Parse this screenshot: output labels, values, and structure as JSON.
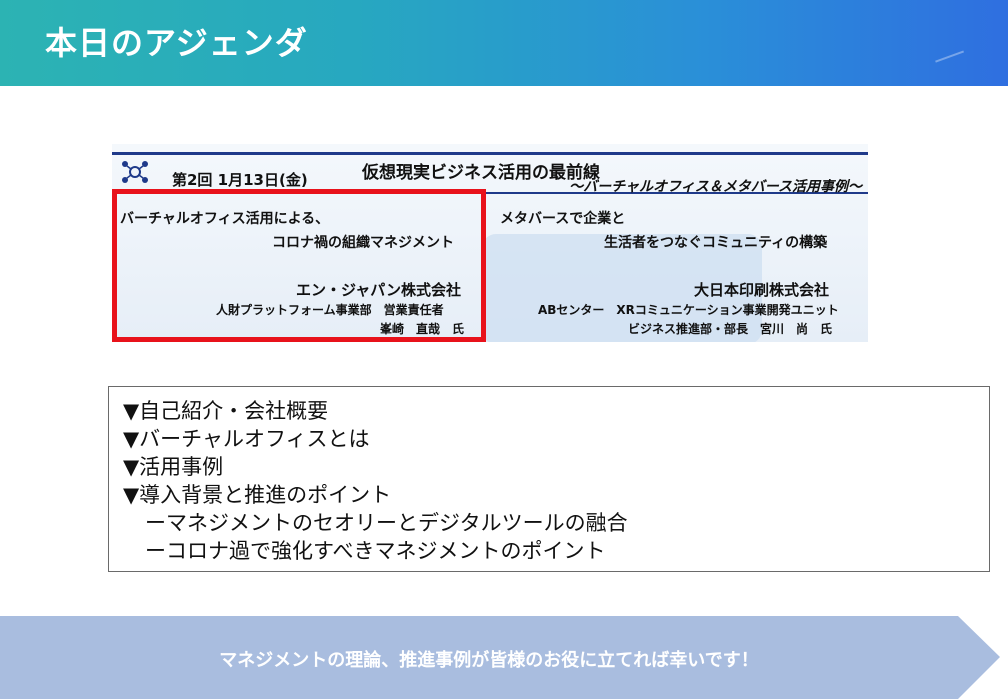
{
  "header": {
    "title": "本日のアジェンダ"
  },
  "banner": {
    "session": "第2回 1月13日(金)",
    "title": "仮想現実ビジネス活用の最前線",
    "subtitle": "～バーチャルオフィス＆メタバース活用事例～",
    "left": {
      "topic_line1": "バーチャルオフィス活用による、",
      "topic_line2": "コロナ禍の組織マネジメント",
      "company": "エン・ジャパン株式会社",
      "dept": "人財プラットフォーム事業部　営業責任者",
      "speaker": "峯崎　直哉　氏"
    },
    "right": {
      "topic_line1": "メタバースで企業と",
      "topic_line2": "生活者をつなぐコミュニティの構築",
      "company": "大日本印刷株式会社",
      "dept": "ABセンター　XRコミュニケーション事業開発ユニット",
      "speaker": "ビジネス推進部・部長　宮川　尚　氏"
    }
  },
  "agenda": {
    "items": [
      "▼自己紹介・会社概要",
      "▼バーチャルオフィスとは",
      "▼活用事例",
      "▼導入背景と推進のポイント"
    ],
    "subitems": [
      "ーマネジメントのセオリーとデジタルツールの融合",
      "ーコロナ過で強化すべきマネジメントのポイント"
    ]
  },
  "footer": {
    "message": "マネジメントの理論、推進事例が皆様のお役に立てれば幸いです！"
  },
  "colors": {
    "header_start": "#2cb3b3",
    "header_end": "#2f6fe0",
    "highlight": "#e8121b",
    "footer_arrow": "#a9bddf"
  }
}
